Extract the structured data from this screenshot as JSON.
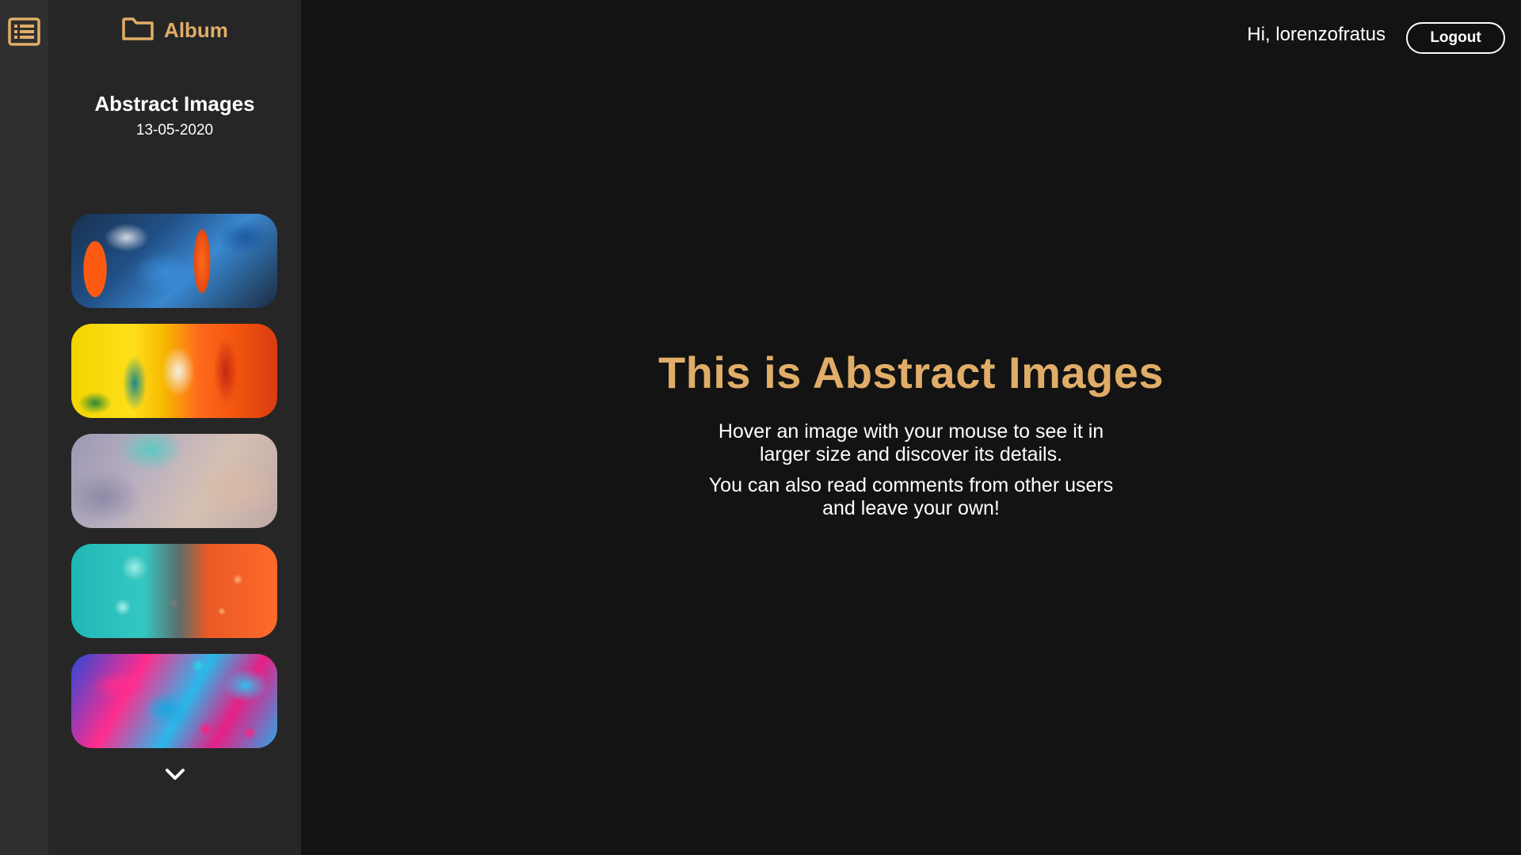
{
  "rail": {
    "menu_icon": "list-icon"
  },
  "sidebar": {
    "album_label": "Album",
    "album_icon": "folder-icon",
    "album_title": "Abstract Images",
    "album_date": "13-05-2020",
    "thumbnails": [
      {
        "name": "abstract-paint-blue-orange"
      },
      {
        "name": "abstract-paint-yellow-red"
      },
      {
        "name": "abstract-marble-lilac"
      },
      {
        "name": "abstract-bubbles-teal-orange"
      },
      {
        "name": "abstract-fluid-pink-cyan"
      }
    ],
    "scroll_icon": "chevron-down-icon"
  },
  "header": {
    "greeting": "Hi, lorenzofratus",
    "logout_label": "Logout"
  },
  "main": {
    "title": "This is Abstract Images",
    "paragraph1": "Hover an image with your mouse to see it in larger size and discover its details.",
    "paragraph2": "You can also read comments from other users and leave your own!"
  },
  "colors": {
    "accent": "#e0ad68",
    "background": "#131313",
    "sidebar": "#262626",
    "rail": "#2f2f2f"
  }
}
